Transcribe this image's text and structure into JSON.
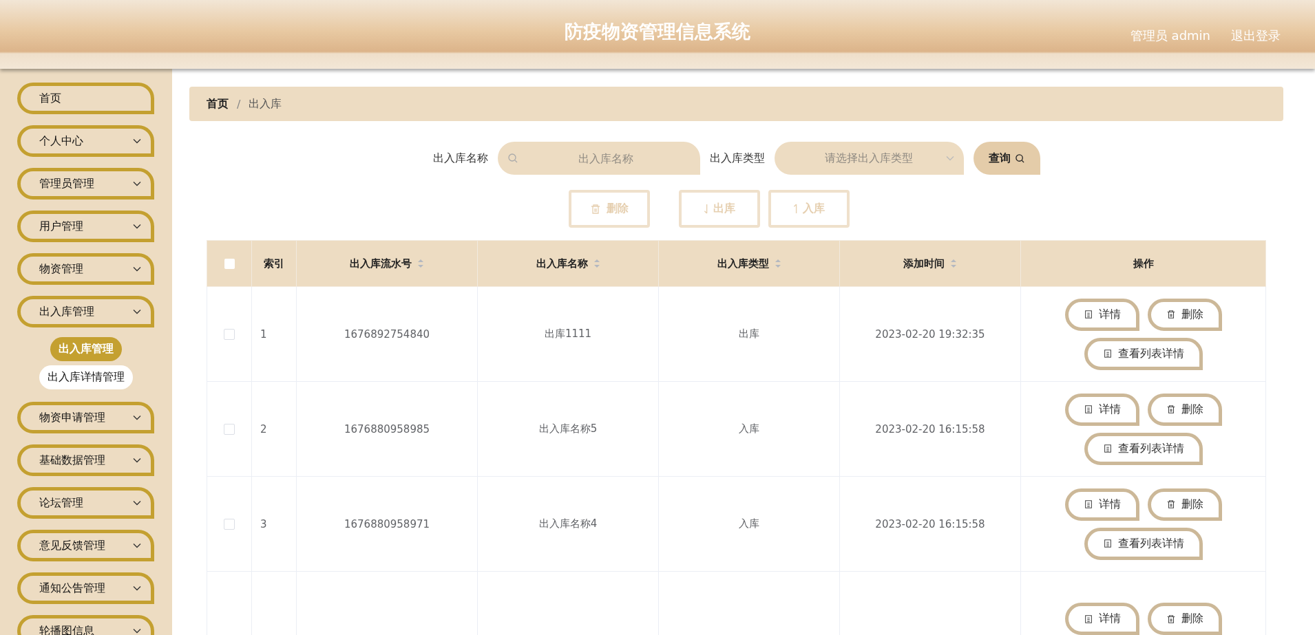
{
  "header": {
    "title": "防疫物资管理信息系统",
    "user": "管理员 admin",
    "logout": "退出登录"
  },
  "sidebar": {
    "items": [
      {
        "label": "首页",
        "expandable": false
      },
      {
        "label": "个人中心",
        "expandable": true
      },
      {
        "label": "管理员管理",
        "expandable": true
      },
      {
        "label": "用户管理",
        "expandable": true
      },
      {
        "label": "物资管理",
        "expandable": true
      },
      {
        "label": "出入库管理",
        "expandable": true,
        "children": [
          {
            "label": "出入库管理",
            "selected": true
          },
          {
            "label": "出入库详情管理",
            "selected": false
          }
        ]
      },
      {
        "label": "物资申请管理",
        "expandable": true
      },
      {
        "label": "基础数据管理",
        "expandable": true
      },
      {
        "label": "论坛管理",
        "expandable": true
      },
      {
        "label": "意见反馈管理",
        "expandable": true
      },
      {
        "label": "通知公告管理",
        "expandable": true
      },
      {
        "label": "轮播图信息",
        "expandable": true
      }
    ]
  },
  "breadcrumb": {
    "separator": "/",
    "items": [
      "首页",
      "出入库"
    ]
  },
  "search": {
    "name_label": "出入库名称",
    "name_placeholder": "出入库名称",
    "type_label": "出入库类型",
    "type_placeholder": "请选择出入库类型",
    "query_button": "查询"
  },
  "toolbar": [
    {
      "label": "删除",
      "kind": "delete",
      "disabled": true
    },
    {
      "label": "出库",
      "kind": "out",
      "disabled": true
    },
    {
      "label": "入库",
      "kind": "in",
      "disabled": true
    }
  ],
  "table": {
    "all_checked": false,
    "columns": [
      {
        "label": "索引",
        "sortable": false
      },
      {
        "label": "出入库流水号",
        "sortable": true
      },
      {
        "label": "出入库名称",
        "sortable": true
      },
      {
        "label": "出入库类型",
        "sortable": true
      },
      {
        "label": "添加时间",
        "sortable": true
      },
      {
        "label": "操作",
        "sortable": false
      }
    ],
    "rows": [
      {
        "checked": false,
        "cells": [
          "1",
          "1676892754840",
          "出库1111",
          "出库",
          "2023-02-20 19:32:35"
        ],
        "actions": [
          "详情",
          "删除",
          "查看列表详情"
        ]
      },
      {
        "checked": false,
        "cells": [
          "2",
          "1676880958985",
          "出入库名称5",
          "入库",
          "2023-02-20 16:15:58"
        ],
        "actions": [
          "详情",
          "删除",
          "查看列表详情"
        ]
      },
      {
        "checked": false,
        "cells": [
          "3",
          "1676880958971",
          "出入库名称4",
          "入库",
          "2023-02-20 16:15:58"
        ],
        "actions": [
          "详情",
          "删除",
          "查看列表详情"
        ]
      },
      {
        "actions": [
          "详情",
          "删除"
        ]
      }
    ]
  }
}
